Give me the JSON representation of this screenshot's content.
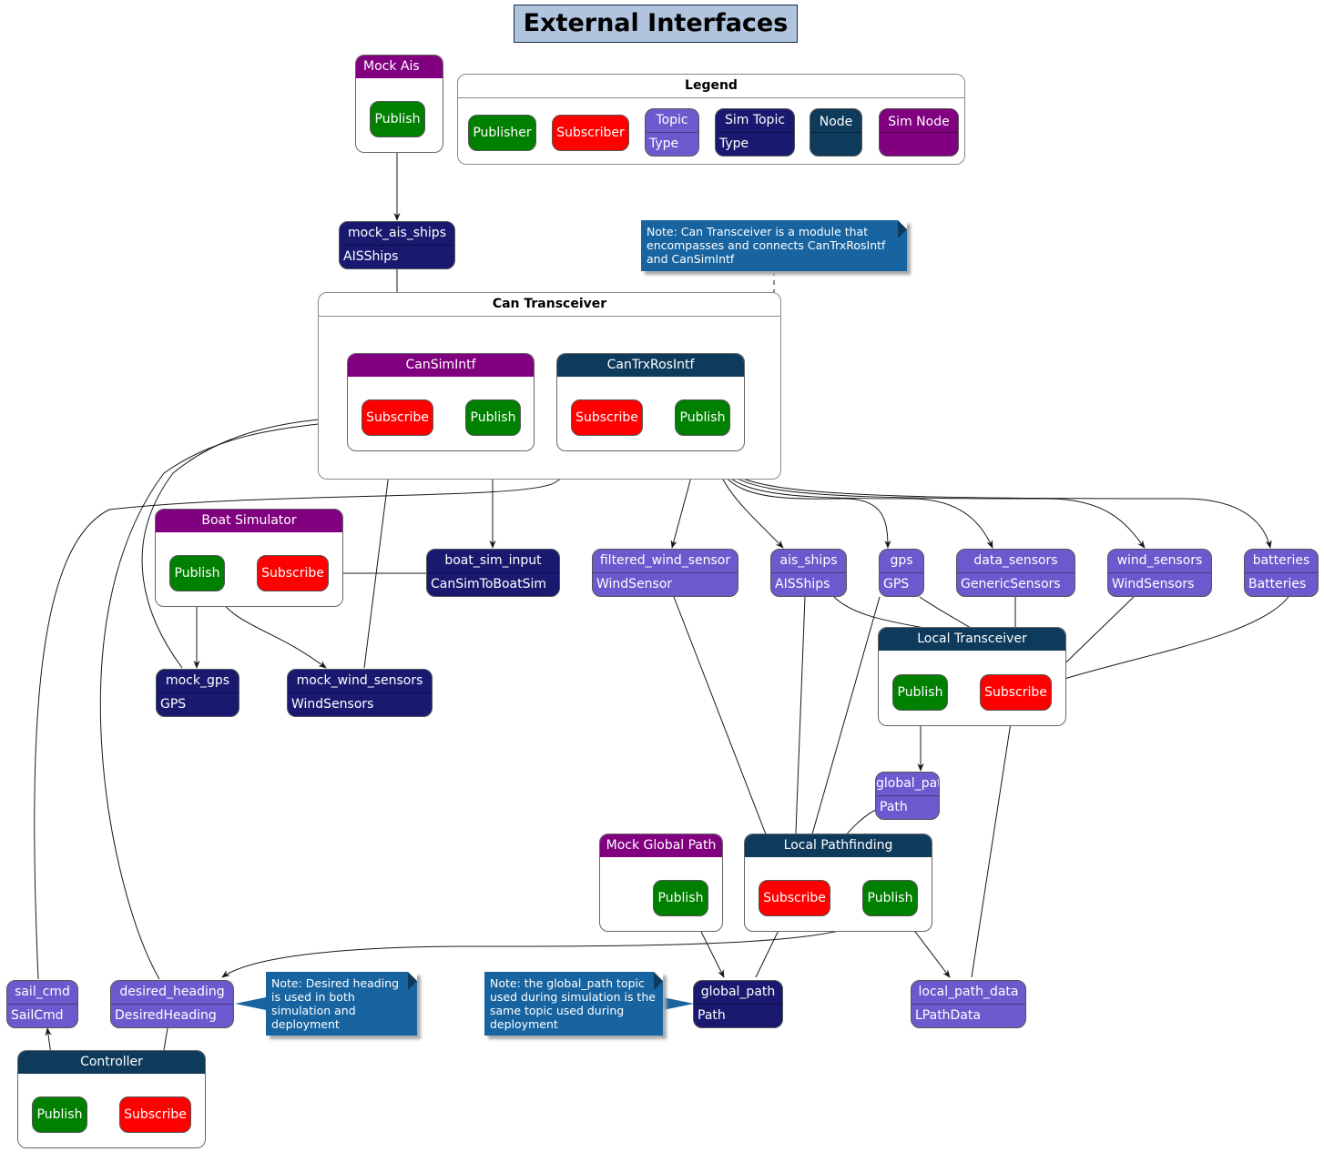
{
  "title": "External Interfaces",
  "legend": {
    "title": "Legend",
    "items": [
      {
        "label": "Publisher"
      },
      {
        "label": "Subscriber"
      },
      {
        "label": "Topic",
        "sub": "Type"
      },
      {
        "label": "Sim Topic",
        "sub": "Type"
      },
      {
        "label": "Node"
      },
      {
        "label": "Sim Node"
      }
    ]
  },
  "colors": {
    "publisher": "#008000",
    "subscriber": "#ff0000",
    "topic": "#6a5acd",
    "sim_topic": "#191970",
    "node": "#0e3a5b",
    "sim_node": "#800080",
    "note": "#1764a0",
    "title_bg": "#b0c4de"
  },
  "groups": {
    "can_transceiver": "Can Transceiver"
  },
  "nodes": {
    "mock_ais": {
      "name": "Mock Ais",
      "publish": "Publish"
    },
    "can_sim_intf": {
      "name": "CanSimIntf",
      "subscribe": "Subscribe",
      "publish": "Publish"
    },
    "can_trx_ros_intf": {
      "name": "CanTrxRosIntf",
      "subscribe": "Subscribe",
      "publish": "Publish"
    },
    "boat_simulator": {
      "name": "Boat Simulator",
      "publish": "Publish",
      "subscribe": "Subscribe"
    },
    "local_transceiver": {
      "name": "Local Transceiver",
      "publish": "Publish",
      "subscribe": "Subscribe"
    },
    "mock_global_path": {
      "name": "Mock Global Path",
      "publish": "Publish"
    },
    "local_pathfinding": {
      "name": "Local Pathfinding",
      "subscribe": "Subscribe",
      "publish": "Publish"
    },
    "controller": {
      "name": "Controller",
      "publish": "Publish",
      "subscribe": "Subscribe"
    }
  },
  "topics": {
    "mock_ais_ships": {
      "name": "mock_ais_ships",
      "type": "AISShips"
    },
    "boat_sim_input": {
      "name": "boat_sim_input",
      "type": "CanSimToBoatSim"
    },
    "mock_gps": {
      "name": "mock_gps",
      "type": "GPS"
    },
    "mock_wind_sensors": {
      "name": "mock_wind_sensors",
      "type": "WindSensors"
    },
    "filtered_wind_sensor": {
      "name": "filtered_wind_sensor",
      "type": "WindSensor"
    },
    "ais_ships": {
      "name": "ais_ships",
      "type": "AISShips"
    },
    "gps": {
      "name": "gps",
      "type": "GPS"
    },
    "data_sensors": {
      "name": "data_sensors",
      "type": "GenericSensors"
    },
    "wind_sensors": {
      "name": "wind_sensors",
      "type": "WindSensors"
    },
    "batteries": {
      "name": "batteries",
      "type": "Batteries"
    },
    "global_path": {
      "name": "global_path",
      "type": "Path"
    },
    "global_path_sim": {
      "name": "global_path",
      "type": "Path"
    },
    "local_path_data": {
      "name": "local_path_data",
      "type": "LPathData"
    },
    "sail_cmd": {
      "name": "sail_cmd",
      "type": "SailCmd"
    },
    "desired_heading": {
      "name": "desired_heading",
      "type": "DesiredHeading"
    }
  },
  "notes": {
    "can_transceiver": "Note: Can Transceiver is a module that encompasses and connects CanTrxRosIntf and CanSimIntf",
    "desired_heading": "Note: Desired heading is used in both simulation and deployment",
    "global_path": "Note: the global_path topic used during simulation is the same topic used during deployment"
  }
}
